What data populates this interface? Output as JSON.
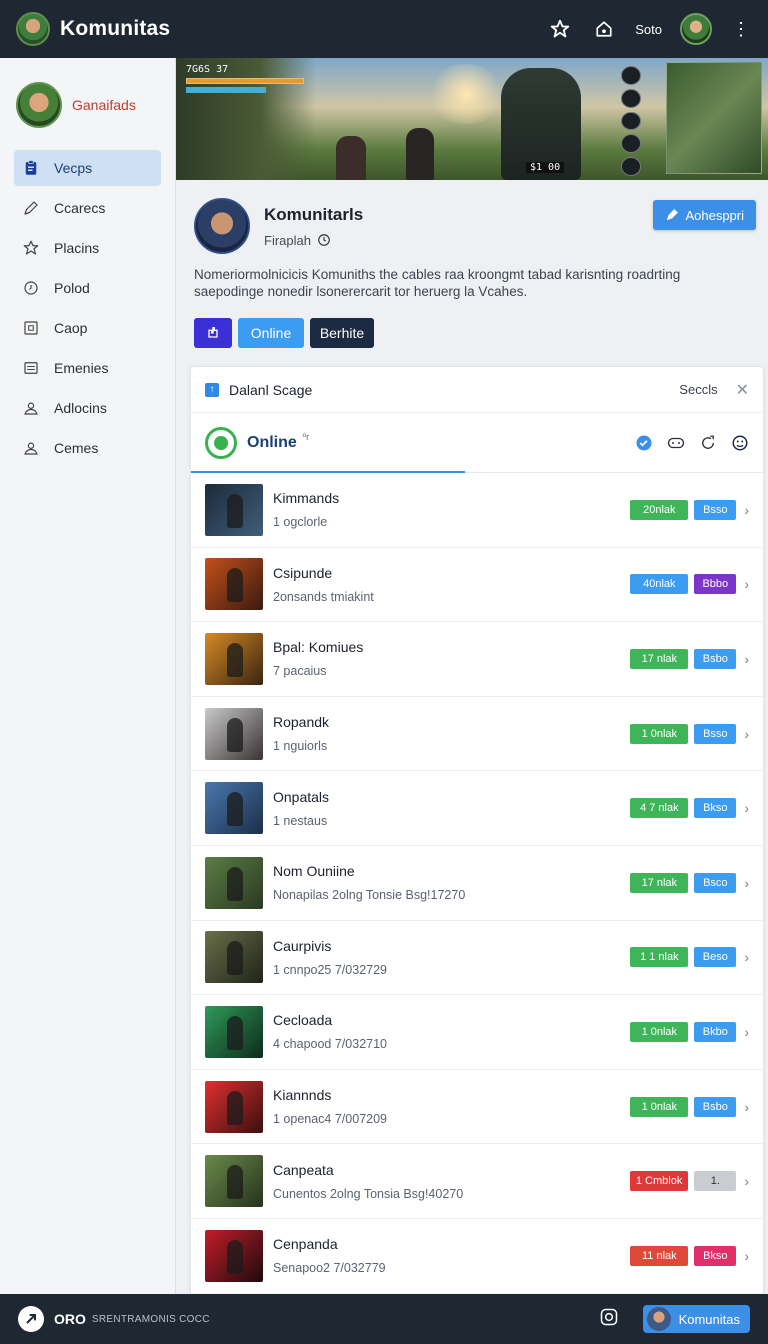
{
  "topbar": {
    "title": "Komunitas",
    "user": "Soto"
  },
  "sidebar": {
    "profile_name": "Ganaifads",
    "items": [
      {
        "label": "Vecps",
        "icon": "clipboard-icon",
        "active": true
      },
      {
        "label": "Ccarecs",
        "icon": "pen-icon"
      },
      {
        "label": "Placins",
        "icon": "star-icon"
      },
      {
        "label": "Polod",
        "icon": "clock-icon"
      },
      {
        "label": "Caop",
        "icon": "box-icon"
      },
      {
        "label": "Emenies",
        "icon": "list-icon"
      },
      {
        "label": "Adlocins",
        "icon": "user-icon"
      },
      {
        "label": "Cemes",
        "icon": "person-icon"
      }
    ]
  },
  "banner": {
    "hud_text": "7G6S  37",
    "ammo_text": "$1 00"
  },
  "community": {
    "title": "Komunitarls",
    "subtitle": "Firaplah",
    "action_label": "Aohesppri",
    "description": "Nomeriormolnicicis Komuniths the cables raa kroongmt tabad karisnting roadrting saepodinge nonedir lsonerercarit tor heruerg la Vcahes.",
    "buttons": {
      "online": "Online",
      "secondary": "Berhite"
    }
  },
  "panel": {
    "title": "Dalanl Scage",
    "right_label": "Seccls",
    "tab_label": "Online",
    "tab_sup": "ºr"
  },
  "rows": [
    {
      "title": "Kimmands",
      "sub": "1 ogclorle",
      "badge": "20nlak",
      "badge_color": "#3fb55a",
      "pill": "Bsso",
      "pill_color": "#3c9cf0",
      "thumb": [
        "#1d2a3a",
        "#3f5f7a"
      ]
    },
    {
      "title": "Csipunde",
      "sub": "2onsands tmiakint",
      "badge": "40nlak",
      "badge_color": "#3c9cf0",
      "pill": "Bbbo",
      "pill_color": "#7b35c9",
      "thumb": [
        "#c5501b",
        "#3a1a0e"
      ]
    },
    {
      "title": "Bpal: Komiues",
      "sub": "7 pacaius",
      "badge": "17 nlak",
      "badge_color": "#3fb55a",
      "pill": "Bsbo",
      "pill_color": "#3c9cf0",
      "thumb": [
        "#d68a25",
        "#3a2410"
      ]
    },
    {
      "title": "Ropandk",
      "sub": "1 nguiorls",
      "badge": "1 0nlak",
      "badge_color": "#3fb55a",
      "pill": "Bsso",
      "pill_color": "#3c9cf0",
      "thumb": [
        "#c9c9c9",
        "#3a3434"
      ]
    },
    {
      "title": "Onpatals",
      "sub": "1 nestaus",
      "badge": "4 7 nlak",
      "badge_color": "#3fb55a",
      "pill": "Bkso",
      "pill_color": "#3c9cf0",
      "thumb": [
        "#4a78b0",
        "#1c2f48"
      ]
    },
    {
      "title": "Nom Ouniine",
      "sub": "Nonapilas 2olng Tonsie Bsg!17270",
      "badge": "17 nlak",
      "badge_color": "#3fb55a",
      "pill": "Bsco",
      "pill_color": "#3c9cf0",
      "thumb": [
        "#5b7d45",
        "#2a3a22"
      ]
    },
    {
      "title": "Caurpivis",
      "sub": "1 cnnpo25 7/032729",
      "badge": "1 1 nlak",
      "badge_color": "#3fb55a",
      "pill": "Beso",
      "pill_color": "#3c9cf0",
      "thumb": [
        "#6a6f4a",
        "#1f2418"
      ]
    },
    {
      "title": "Cecloada",
      "sub": "4 chapood 7/032710",
      "badge": "1 0nlak",
      "badge_color": "#3fb55a",
      "pill": "Bkbo",
      "pill_color": "#3c9cf0",
      "thumb": [
        "#2e9a5a",
        "#0e2a1a"
      ]
    },
    {
      "title": "Kiannnds",
      "sub": "1 openac4 7/007209",
      "badge": "1 0nlak",
      "badge_color": "#3fb55a",
      "pill": "Bsbo",
      "pill_color": "#3c9cf0",
      "thumb": [
        "#e03030",
        "#3a0e0e"
      ]
    },
    {
      "title": "Canpeata",
      "sub": "Cunentos 2olng Tonsia Bsg!40270",
      "badge": "1 Cmblok",
      "badge_color": "#e03838",
      "pill": "1.",
      "pill_color": "#c9cdd2",
      "thumb": [
        "#6b8a4a",
        "#25331c"
      ]
    },
    {
      "title": "Cenpanda",
      "sub": "Senapoo2 7/032779",
      "badge": "11 nlak",
      "badge_color": "#e0493a",
      "pill": "Bkso",
      "pill_color": "#e0306a",
      "thumb": [
        "#c21e2a",
        "#1c0a0c"
      ]
    }
  ],
  "bottombar": {
    "brand": "ORO",
    "tagline": "SRENTRAMONIS COCC",
    "chip_label": "Komunitas"
  }
}
